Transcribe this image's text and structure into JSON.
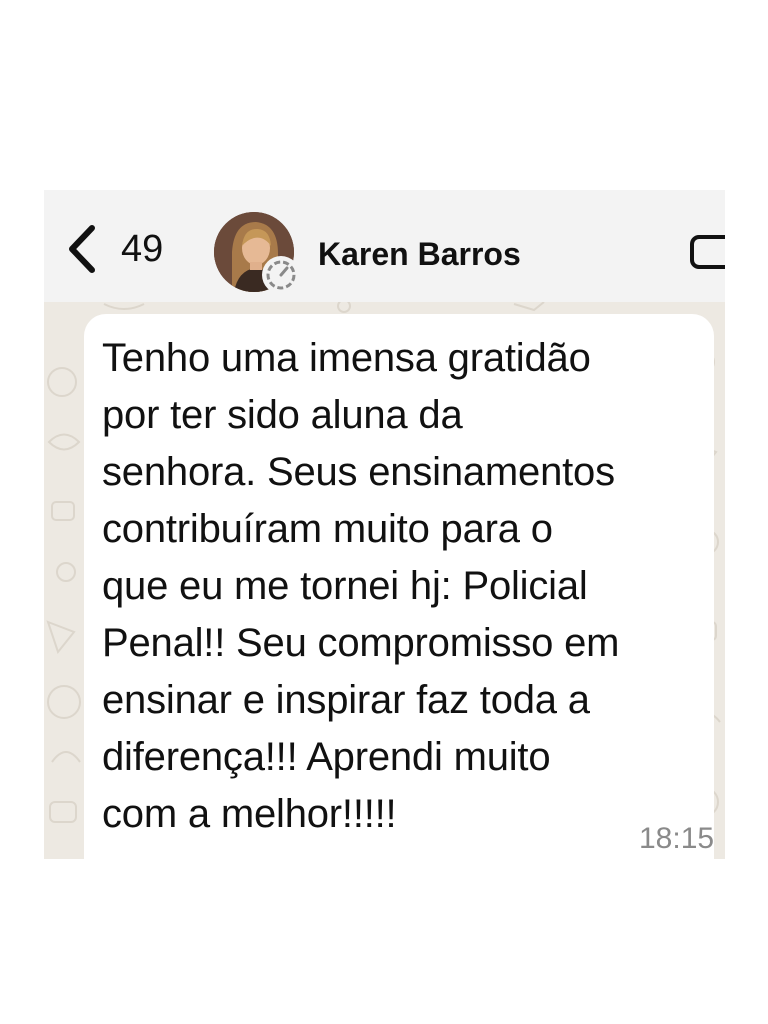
{
  "header": {
    "unread_count": "49",
    "contact_name": "Karen Barros"
  },
  "message": {
    "text": "Tenho uma imensa gratidão\npor ter sido aluna da\nsenhora. Seus ensinamentos\ncontribuíram muito para o\nque eu me tornei hj: Policial\nPenal!! Seu compromisso em\nensinar e inspirar faz toda a\ndiferença!!! Aprendi muito\ncom a melhor!!!!!",
    "time": "18:15"
  },
  "icons": {
    "back": "chevron-left-icon",
    "status": "status-ring-icon",
    "video": "video-call-icon"
  },
  "colors": {
    "chat_background": "#ede9e2",
    "bubble": "#ffffff",
    "header": "#f3f3f3",
    "timestamp": "#8a8a8a"
  }
}
